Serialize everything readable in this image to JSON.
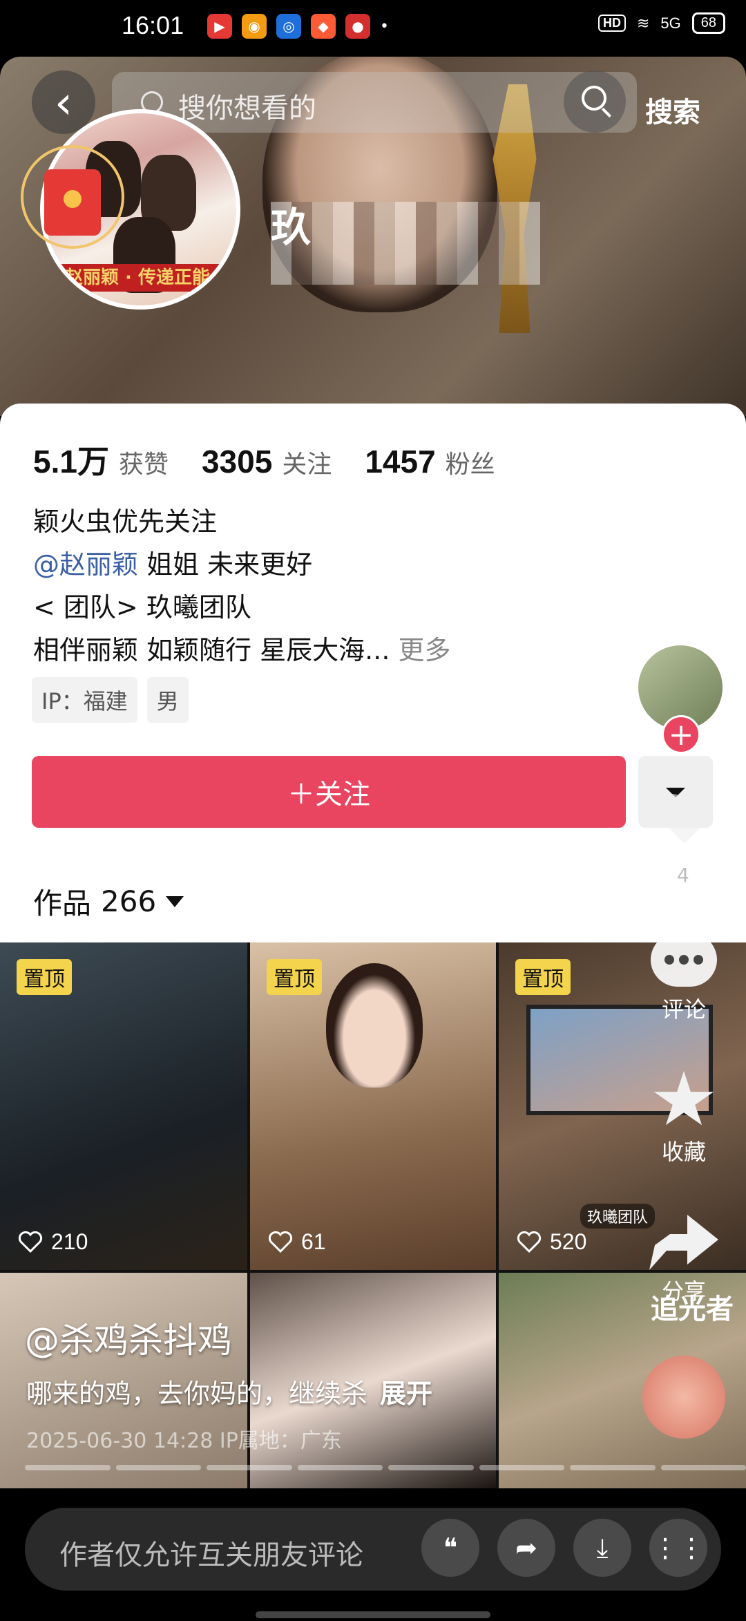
{
  "status_bar": {
    "time": "16:01",
    "hd": "HD",
    "signal": "5G",
    "battery": "68"
  },
  "header": {
    "back": "‹",
    "search_placeholder": "搜你想看的",
    "search_button": "搜索",
    "name_visible_char": "玖"
  },
  "avatar": {
    "banner_text": "赵丽颖 · 传递正能"
  },
  "stats": [
    {
      "value": "5.1万",
      "label": "获赞"
    },
    {
      "value": "3305",
      "label": "关注"
    },
    {
      "value": "1457",
      "label": "粉丝"
    }
  ],
  "bio": {
    "line1": "颖火虫优先关注",
    "mention": "@赵丽颖",
    "line2_rest": " 姐姐  未来更好",
    "line3": "< 团队> 玖曦团队",
    "line4": "相伴丽颖  如颖随行  星辰大海...",
    "more": " 更多"
  },
  "tags": [
    "IP：福建",
    "男"
  ],
  "follow_button": "＋关注",
  "works": {
    "label": "作品",
    "count": "266"
  },
  "float": {
    "plus": "+",
    "count": "4"
  },
  "grid": [
    {
      "pinned": "置顶",
      "likes": "210"
    },
    {
      "pinned": "置顶",
      "likes": "61"
    },
    {
      "pinned": "置顶",
      "likes": "520",
      "tag": "玖曦团队"
    },
    {
      "title": ""
    },
    {
      "title": ""
    },
    {
      "title": "追光者"
    }
  ],
  "side_actions": {
    "comment": "评论",
    "favorite": "收藏",
    "share": "分享"
  },
  "overlay": {
    "author": "@杀鸡杀抖鸡",
    "caption": "哪来的鸡，去你妈的，继续杀",
    "expand": "展开",
    "meta": "2025-06-30 14:28  IP属地：广东"
  },
  "comment_bar": {
    "placeholder": "作者仅允许互关朋友评论"
  },
  "colors": {
    "accent": "#e94460",
    "pin": "#f4d44c",
    "mention": "#3b5fa7"
  }
}
